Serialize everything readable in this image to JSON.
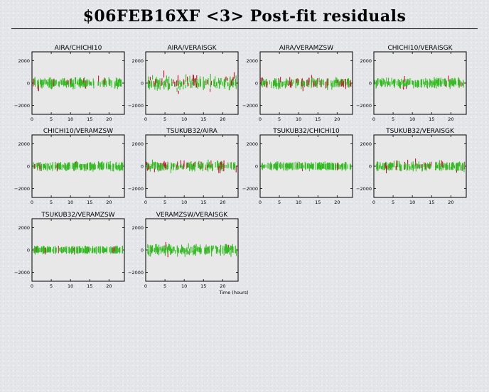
{
  "page": {
    "title": "$06FEB16XF <3> Post-fit residuals"
  },
  "colors": {
    "series_a": "#33bb22",
    "series_b": "#cc1133",
    "plot_bg": "#e8e8e8"
  },
  "axes": {
    "x_ticks": [
      "0",
      "5",
      "10",
      "15",
      "20"
    ],
    "x_tick_values": [
      0,
      5,
      10,
      15,
      20
    ],
    "y_ticks": [
      "2000",
      "0",
      "−2000"
    ],
    "y_tick_values": [
      2000,
      0,
      -2000
    ],
    "xlim": [
      0,
      24
    ],
    "ylim": [
      -2800,
      2800
    ],
    "xlabel": "Time (hours)"
  },
  "chart_data": [
    {
      "type": "scatter",
      "title": "AIRA/CHICHI10",
      "spread_a": 250,
      "spread_b": 550,
      "frac_b": 0.16
    },
    {
      "type": "scatter",
      "title": "AIRA/VERAISGK",
      "spread_a": 420,
      "spread_b": 650,
      "frac_b": 0.18
    },
    {
      "type": "scatter",
      "title": "AIRA/VERAMZSW",
      "spread_a": 260,
      "spread_b": 500,
      "frac_b": 0.2
    },
    {
      "type": "scatter",
      "title": "CHICHI10/VERAISGK",
      "spread_a": 220,
      "spread_b": 350,
      "frac_b": 0.05
    },
    {
      "type": "scatter",
      "title": "CHICHI10/VERAMZSW",
      "spread_a": 140,
      "spread_b": 250,
      "frac_b": 0.04
    },
    {
      "type": "scatter",
      "title": "TSUKUB32/AIRA",
      "spread_a": 230,
      "spread_b": 380,
      "frac_b": 0.28
    },
    {
      "type": "scatter",
      "title": "TSUKUB32/CHICHI10",
      "spread_a": 100,
      "spread_b": 150,
      "frac_b": 0.04
    },
    {
      "type": "scatter",
      "title": "TSUKUB32/VERAISGK",
      "spread_a": 220,
      "spread_b": 320,
      "frac_b": 0.13
    },
    {
      "type": "scatter",
      "title": "TSUKUB32/VERAMZSW",
      "spread_a": 90,
      "spread_b": 150,
      "frac_b": 0.06
    },
    {
      "type": "scatter",
      "title": "VERAMZSW/VERAISGK",
      "spread_a": 300,
      "spread_b": 650,
      "frac_b": 0.07
    }
  ]
}
